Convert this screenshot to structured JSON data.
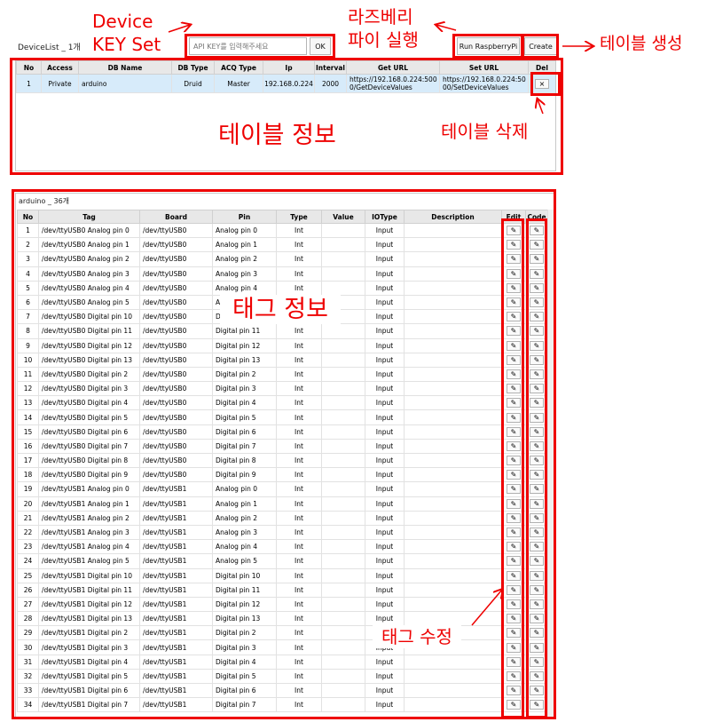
{
  "annotations": {
    "device_key_line1": "Device",
    "device_key_line2": "KEY Set",
    "run_pi_line1": "라즈베리",
    "run_pi_line2": "파이 실행",
    "table_create": "테이블 생성",
    "table_info": "테이블 정보",
    "table_delete": "테이블 삭제",
    "tag_info": "태그 정보",
    "tag_edit": "태그 수정"
  },
  "colors": {
    "annotation": "#ee0000",
    "selected_row": "#d7ebfa",
    "header_bg": "#e8e8e8"
  },
  "header": {
    "device_list_label": "DeviceList _ 1개",
    "api_placeholder": "API KEY를 입력해주세요",
    "ok_label": "OK",
    "run_label": "Run RaspberryPi",
    "create_label": "Create"
  },
  "device_table": {
    "columns": [
      "No",
      "Access",
      "DB Name",
      "DB Type",
      "ACQ Type",
      "Ip",
      "Interval",
      "Get URL",
      "Set URL",
      "Del"
    ],
    "rows": [
      {
        "no": "1",
        "access": "Private",
        "db_name": "arduino",
        "db_type": "Druid",
        "acq_type": "Master",
        "ip": "192.168.0.224",
        "interval": "2000",
        "get_url": "https://192.168.0.224:5000/GetDeviceValues",
        "set_url": "https://192.168.0.224:5000/SetDeviceValues",
        "del": "×"
      }
    ]
  },
  "tag_table": {
    "caption": "arduino _ 36개",
    "columns": [
      "No",
      "Tag",
      "Board",
      "Pin",
      "Type",
      "Value",
      "IOType",
      "Description",
      "Edit",
      "Code"
    ],
    "edit_glyph": "✎",
    "rows": [
      {
        "no": "1",
        "tag": "/dev/ttyUSB0 Analog pin 0",
        "board": "/dev/ttyUSB0",
        "pin": "Analog pin 0",
        "type": "Int",
        "value": "",
        "io": "Input",
        "desc": ""
      },
      {
        "no": "2",
        "tag": "/dev/ttyUSB0 Analog pin 1",
        "board": "/dev/ttyUSB0",
        "pin": "Analog pin 1",
        "type": "Int",
        "value": "",
        "io": "Input",
        "desc": ""
      },
      {
        "no": "3",
        "tag": "/dev/ttyUSB0 Analog pin 2",
        "board": "/dev/ttyUSB0",
        "pin": "Analog pin 2",
        "type": "Int",
        "value": "",
        "io": "Input",
        "desc": ""
      },
      {
        "no": "4",
        "tag": "/dev/ttyUSB0 Analog pin 3",
        "board": "/dev/ttyUSB0",
        "pin": "Analog pin 3",
        "type": "Int",
        "value": "",
        "io": "Input",
        "desc": ""
      },
      {
        "no": "5",
        "tag": "/dev/ttyUSB0 Analog pin 4",
        "board": "/dev/ttyUSB0",
        "pin": "Analog pin 4",
        "type": "Int",
        "value": "",
        "io": "Input",
        "desc": ""
      },
      {
        "no": "6",
        "tag": "/dev/ttyUSB0 Analog pin 5",
        "board": "/dev/ttyUSB0",
        "pin": "Analog pin 5",
        "type": "Int",
        "value": "",
        "io": "Input",
        "desc": ""
      },
      {
        "no": "7",
        "tag": "/dev/ttyUSB0 Digital pin 10",
        "board": "/dev/ttyUSB0",
        "pin": "Digital pin 10",
        "type": "Int",
        "value": "",
        "io": "Input",
        "desc": ""
      },
      {
        "no": "8",
        "tag": "/dev/ttyUSB0 Digital pin 11",
        "board": "/dev/ttyUSB0",
        "pin": "Digital pin 11",
        "type": "Int",
        "value": "",
        "io": "Input",
        "desc": ""
      },
      {
        "no": "9",
        "tag": "/dev/ttyUSB0 Digital pin 12",
        "board": "/dev/ttyUSB0",
        "pin": "Digital pin 12",
        "type": "Int",
        "value": "",
        "io": "Input",
        "desc": ""
      },
      {
        "no": "10",
        "tag": "/dev/ttyUSB0 Digital pin 13",
        "board": "/dev/ttyUSB0",
        "pin": "Digital pin 13",
        "type": "Int",
        "value": "",
        "io": "Input",
        "desc": ""
      },
      {
        "no": "11",
        "tag": "/dev/ttyUSB0 Digital pin 2",
        "board": "/dev/ttyUSB0",
        "pin": "Digital pin 2",
        "type": "Int",
        "value": "",
        "io": "Input",
        "desc": ""
      },
      {
        "no": "12",
        "tag": "/dev/ttyUSB0 Digital pin 3",
        "board": "/dev/ttyUSB0",
        "pin": "Digital pin 3",
        "type": "Int",
        "value": "",
        "io": "Input",
        "desc": ""
      },
      {
        "no": "13",
        "tag": "/dev/ttyUSB0 Digital pin 4",
        "board": "/dev/ttyUSB0",
        "pin": "Digital pin 4",
        "type": "Int",
        "value": "",
        "io": "Input",
        "desc": ""
      },
      {
        "no": "14",
        "tag": "/dev/ttyUSB0 Digital pin 5",
        "board": "/dev/ttyUSB0",
        "pin": "Digital pin 5",
        "type": "Int",
        "value": "",
        "io": "Input",
        "desc": ""
      },
      {
        "no": "15",
        "tag": "/dev/ttyUSB0 Digital pin 6",
        "board": "/dev/ttyUSB0",
        "pin": "Digital pin 6",
        "type": "Int",
        "value": "",
        "io": "Input",
        "desc": ""
      },
      {
        "no": "16",
        "tag": "/dev/ttyUSB0 Digital pin 7",
        "board": "/dev/ttyUSB0",
        "pin": "Digital pin 7",
        "type": "Int",
        "value": "",
        "io": "Input",
        "desc": ""
      },
      {
        "no": "17",
        "tag": "/dev/ttyUSB0 Digital pin 8",
        "board": "/dev/ttyUSB0",
        "pin": "Digital pin 8",
        "type": "Int",
        "value": "",
        "io": "Input",
        "desc": ""
      },
      {
        "no": "18",
        "tag": "/dev/ttyUSB0 Digital pin 9",
        "board": "/dev/ttyUSB0",
        "pin": "Digital pin 9",
        "type": "Int",
        "value": "",
        "io": "Input",
        "desc": ""
      },
      {
        "no": "19",
        "tag": "/dev/ttyUSB1 Analog pin 0",
        "board": "/dev/ttyUSB1",
        "pin": "Analog pin 0",
        "type": "Int",
        "value": "",
        "io": "Input",
        "desc": ""
      },
      {
        "no": "20",
        "tag": "/dev/ttyUSB1 Analog pin 1",
        "board": "/dev/ttyUSB1",
        "pin": "Analog pin 1",
        "type": "Int",
        "value": "",
        "io": "Input",
        "desc": ""
      },
      {
        "no": "21",
        "tag": "/dev/ttyUSB1 Analog pin 2",
        "board": "/dev/ttyUSB1",
        "pin": "Analog pin 2",
        "type": "Int",
        "value": "",
        "io": "Input",
        "desc": ""
      },
      {
        "no": "22",
        "tag": "/dev/ttyUSB1 Analog pin 3",
        "board": "/dev/ttyUSB1",
        "pin": "Analog pin 3",
        "type": "Int",
        "value": "",
        "io": "Input",
        "desc": ""
      },
      {
        "no": "23",
        "tag": "/dev/ttyUSB1 Analog pin 4",
        "board": "/dev/ttyUSB1",
        "pin": "Analog pin 4",
        "type": "Int",
        "value": "",
        "io": "Input",
        "desc": ""
      },
      {
        "no": "24",
        "tag": "/dev/ttyUSB1 Analog pin 5",
        "board": "/dev/ttyUSB1",
        "pin": "Analog pin 5",
        "type": "Int",
        "value": "",
        "io": "Input",
        "desc": ""
      },
      {
        "no": "25",
        "tag": "/dev/ttyUSB1 Digital pin 10",
        "board": "/dev/ttyUSB1",
        "pin": "Digital pin 10",
        "type": "Int",
        "value": "",
        "io": "Input",
        "desc": ""
      },
      {
        "no": "26",
        "tag": "/dev/ttyUSB1 Digital pin 11",
        "board": "/dev/ttyUSB1",
        "pin": "Digital pin 11",
        "type": "Int",
        "value": "",
        "io": "Input",
        "desc": ""
      },
      {
        "no": "27",
        "tag": "/dev/ttyUSB1 Digital pin 12",
        "board": "/dev/ttyUSB1",
        "pin": "Digital pin 12",
        "type": "Int",
        "value": "",
        "io": "Input",
        "desc": ""
      },
      {
        "no": "28",
        "tag": "/dev/ttyUSB1 Digital pin 13",
        "board": "/dev/ttyUSB1",
        "pin": "Digital pin 13",
        "type": "Int",
        "value": "",
        "io": "Input",
        "desc": ""
      },
      {
        "no": "29",
        "tag": "/dev/ttyUSB1 Digital pin 2",
        "board": "/dev/ttyUSB1",
        "pin": "Digital pin 2",
        "type": "Int",
        "value": "",
        "io": "Input",
        "desc": ""
      },
      {
        "no": "30",
        "tag": "/dev/ttyUSB1 Digital pin 3",
        "board": "/dev/ttyUSB1",
        "pin": "Digital pin 3",
        "type": "Int",
        "value": "",
        "io": "Input",
        "desc": ""
      },
      {
        "no": "31",
        "tag": "/dev/ttyUSB1 Digital pin 4",
        "board": "/dev/ttyUSB1",
        "pin": "Digital pin 4",
        "type": "Int",
        "value": "",
        "io": "Input",
        "desc": ""
      },
      {
        "no": "32",
        "tag": "/dev/ttyUSB1 Digital pin 5",
        "board": "/dev/ttyUSB1",
        "pin": "Digital pin 5",
        "type": "Int",
        "value": "",
        "io": "Input",
        "desc": ""
      },
      {
        "no": "33",
        "tag": "/dev/ttyUSB1 Digital pin 6",
        "board": "/dev/ttyUSB1",
        "pin": "Digital pin 6",
        "type": "Int",
        "value": "",
        "io": "Input",
        "desc": ""
      },
      {
        "no": "34",
        "tag": "/dev/ttyUSB1 Digital pin 7",
        "board": "/dev/ttyUSB1",
        "pin": "Digital pin 7",
        "type": "Int",
        "value": "",
        "io": "Input",
        "desc": ""
      }
    ]
  }
}
